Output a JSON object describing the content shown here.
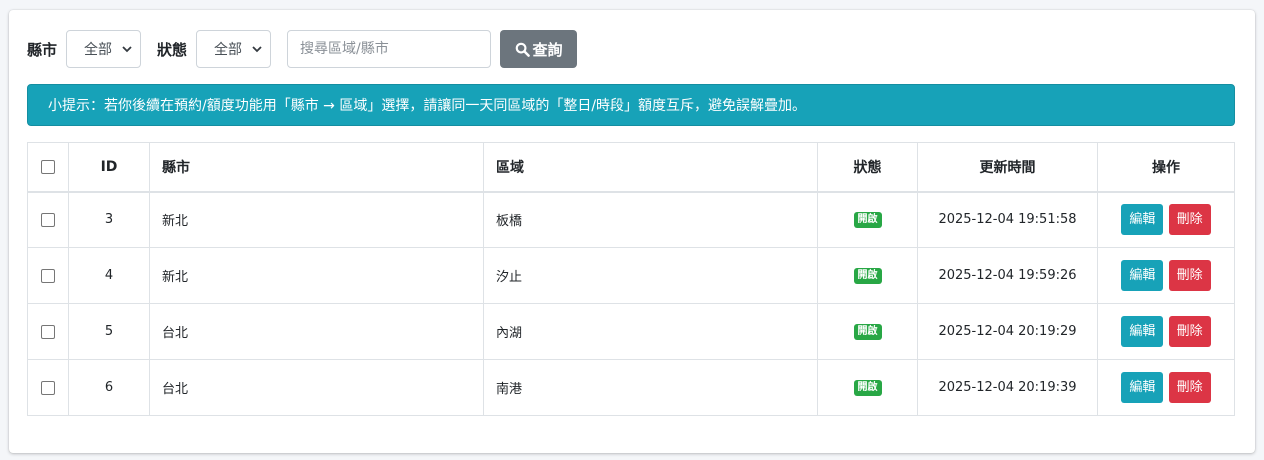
{
  "filters": {
    "city_label": "縣市",
    "city_value": "全部",
    "status_label": "狀態",
    "status_value": "全部",
    "search_placeholder": "搜尋區域/縣市",
    "search_button": "查詢"
  },
  "alert": {
    "text": "小提示：若你後續在預約/額度功能用「縣市 → 區域」選擇，請讓同一天同區域的「整日/時段」額度互斥，避免誤解疊加。"
  },
  "table": {
    "headers": [
      "",
      "ID",
      "縣市",
      "區域",
      "狀態",
      "更新時間",
      "操作"
    ],
    "rows": [
      {
        "id": "3",
        "city": "新北",
        "area": "板橋",
        "status": "開啟",
        "updated": "2025-12-04 19:51:58"
      },
      {
        "id": "4",
        "city": "新北",
        "area": "汐止",
        "status": "開啟",
        "updated": "2025-12-04 19:59:26"
      },
      {
        "id": "5",
        "city": "台北",
        "area": "內湖",
        "status": "開啟",
        "updated": "2025-12-04 20:19:29"
      },
      {
        "id": "6",
        "city": "台北",
        "area": "南港",
        "status": "開啟",
        "updated": "2025-12-04 20:19:39"
      }
    ],
    "edit_label": "編輯",
    "delete_label": "刪除"
  },
  "colors": {
    "info": "#17a2b8",
    "success": "#28a745",
    "danger": "#dc3545",
    "secondary": "#6c757d"
  }
}
